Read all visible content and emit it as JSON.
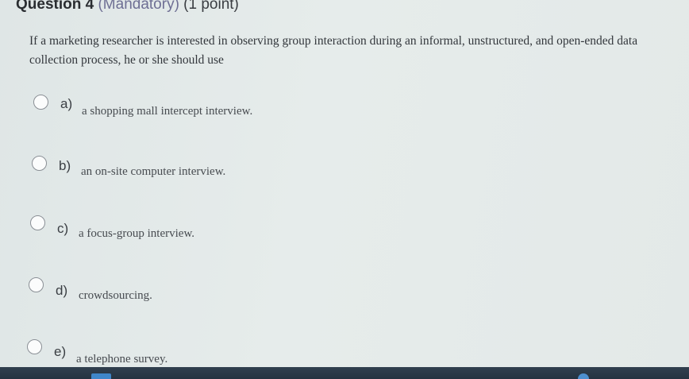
{
  "question": {
    "title": "Question 4",
    "mandatory": "(Mandatory)",
    "points": "(1 point)",
    "text": "If a marketing researcher is interested in observing group interaction during an informal, unstructured, and open-ended data collection process, he or she should use"
  },
  "options": [
    {
      "letter": "a)",
      "text": "a shopping mall intercept interview."
    },
    {
      "letter": "b)",
      "text": "an on-site computer interview."
    },
    {
      "letter": "c)",
      "text": "a focus-group interview."
    },
    {
      "letter": "d)",
      "text": "crowdsourcing."
    },
    {
      "letter": "e)",
      "text": "a telephone survey."
    }
  ],
  "colors": {
    "mandatory": "#6e6f94",
    "taskbar": "#2b3a48"
  }
}
